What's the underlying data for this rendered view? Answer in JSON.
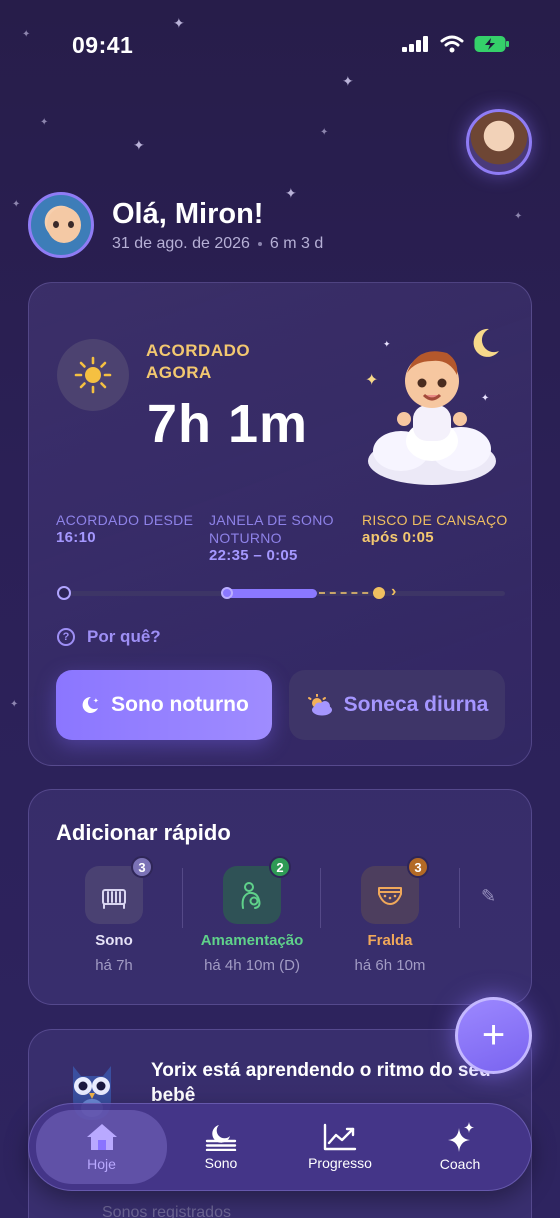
{
  "status_bar": {
    "time": "09:41"
  },
  "greeting": {
    "title": "Olá, Miron!",
    "date": "31 de ago. de 2026",
    "age": "6 m 3 d"
  },
  "status_card": {
    "state_label": "ACORDADO AGORA",
    "duration": "7h 1m",
    "metrics": [
      {
        "label": "ACORDADO DESDE",
        "value": "16:10"
      },
      {
        "label": "JANELA DE SONO NOTURNO",
        "value": "22:35 – 0:05"
      },
      {
        "label": "RISCO DE CANSAÇO",
        "value": "após 0:05"
      }
    ],
    "why_label": "Por quê?",
    "buttons": {
      "night": "Sono noturno",
      "nap": "Soneca diurna"
    }
  },
  "quick_add": {
    "title": "Adicionar rápido",
    "items": [
      {
        "name": "Sono",
        "ago": "há 7h",
        "count": "3",
        "color": "#d9d5f0",
        "badge_color": "#7b72b6",
        "icon": "crib-icon"
      },
      {
        "name": "Amamentação",
        "ago": "há 4h 10m (D)",
        "count": "2",
        "color": "#5fd18a",
        "badge_color": "#2e9a55",
        "icon": "breastfeeding-icon"
      },
      {
        "name": "Fralda",
        "ago": "há 6h 10m",
        "count": "3",
        "color": "#f0a85a",
        "badge_color": "#b36a25",
        "icon": "diaper-icon"
      }
    ]
  },
  "coach_card": {
    "title": "Yorix está aprendendo o ritmo do seu bebê",
    "hidden_row": "Sonos registrados"
  },
  "nav": {
    "tabs": [
      {
        "label": "Hoje",
        "icon": "home-icon"
      },
      {
        "label": "Sono",
        "icon": "moon-waves-icon"
      },
      {
        "label": "Progresso",
        "icon": "trend-chart-icon"
      },
      {
        "label": "Coach",
        "icon": "sparkles-icon"
      }
    ]
  },
  "colors": {
    "accent": "#8b78ff",
    "warning": "#f3c870",
    "background": "#2b2056"
  }
}
